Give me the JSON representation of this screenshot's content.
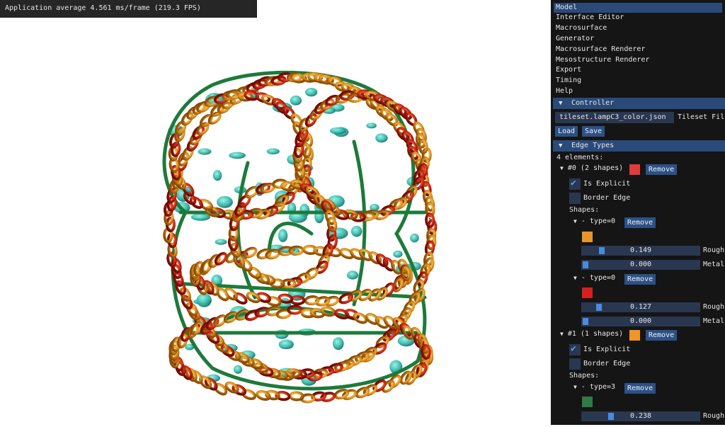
{
  "overlay": {
    "fps_text": "Application average 4.561 ms/frame (219.3 FPS)"
  },
  "menu": {
    "items": [
      "Model",
      "Interface Editor",
      "Macrosurface",
      "Generator",
      "Macrosurface Renderer",
      "Mesostructure Renderer",
      "Export",
      "Timing",
      "Help"
    ],
    "selected": "Model"
  },
  "controller": {
    "header": "Controller",
    "tileset_value": "tileset.lampC3_color.json",
    "tileset_label": "Tileset Fil",
    "load_label": "Load",
    "save_label": "Save"
  },
  "edge_types": {
    "header": "Edge Types",
    "count_text": "4 elements:",
    "remove_label": "Remove",
    "is_explicit_label": "Is Explicit",
    "border_edge_label": "Border Edge",
    "shapes_label": "Shapes:",
    "rough_label": "Rough",
    "metal_label": "Metal",
    "items": [
      {
        "title": "#0 (2 shapes)",
        "color": "#e03a3a",
        "is_explicit": true,
        "border_edge": false,
        "shapes": [
          {
            "title": "- type=0",
            "color": "#e8962c",
            "roughness": "0.149",
            "metallic": "0.000"
          },
          {
            "title": "- type=0",
            "color": "#d81f1f",
            "roughness": "0.127",
            "metallic": "0.000"
          }
        ]
      },
      {
        "title": "#1 (1 shapes)",
        "color": "#ef9625",
        "is_explicit": true,
        "border_edge": false,
        "shapes": [
          {
            "title": "- type=3",
            "color": "#2f7a45",
            "roughness": "0.238"
          }
        ]
      }
    ]
  },
  "colors": {
    "accent": "#2a4a7a",
    "panel_bg": "#151515",
    "frame_bg": "#2a3750",
    "ring_orange": "#e39a22",
    "ring_red": "#d42a12",
    "rod_green": "#1d7a3a",
    "tile_teal": "#2bb5a6"
  }
}
